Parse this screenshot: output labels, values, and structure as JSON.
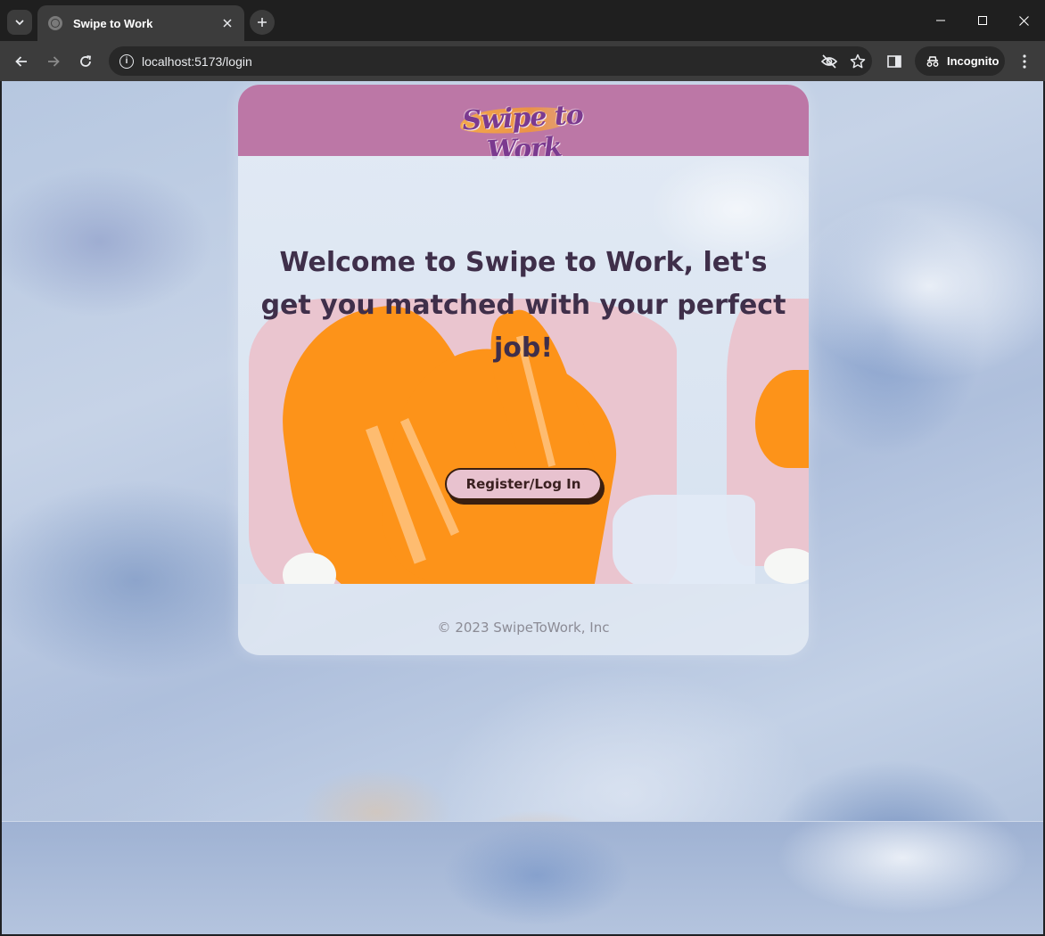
{
  "browser": {
    "tab_title": "Swipe to Work",
    "url": "localhost:5173/login",
    "incognito_label": "Incognito"
  },
  "page": {
    "logo_text": "Swipe to Work",
    "headline": "Welcome to Swipe to Work, let's get you matched with your perfect job!",
    "cta_label": "Register/Log In",
    "copyright": "© 2023 SwipeToWork, Inc"
  },
  "colors": {
    "header_bg": "#bc77a6",
    "headline_text": "#3f2f4a",
    "button_bg": "#e8c2cf",
    "button_border": "#3a1f10",
    "orange_accent": "#fd9319",
    "pink_accent": "#eac5cf"
  },
  "icons": {
    "tab_menu": "chevron-down-icon",
    "tab_close": "close-icon",
    "new_tab": "plus-icon",
    "back": "arrow-left-icon",
    "forward": "arrow-right-icon",
    "reload": "reload-icon",
    "site_info": "info-icon",
    "eye_off": "eye-off-icon",
    "bookmark": "star-icon",
    "side_panel": "side-panel-icon",
    "incognito": "incognito-icon",
    "menu": "kebab-menu-icon"
  }
}
